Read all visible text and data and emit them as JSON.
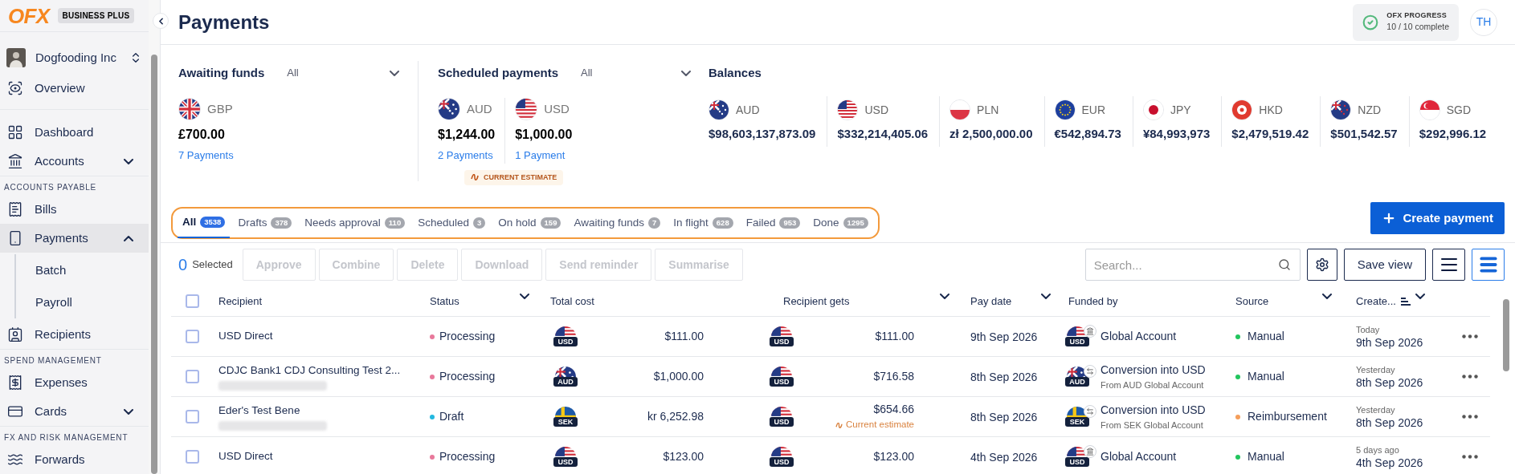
{
  "sidebar": {
    "logo": "OFX",
    "plan": "BUSINESS PLUS",
    "org": "Dogfooding Inc",
    "groups": [
      {
        "items": [
          {
            "label": "Overview",
            "selected": false
          }
        ]
      },
      {
        "items": [
          {
            "label": "Dashboard",
            "selected": false
          },
          {
            "label": "Accounts",
            "selected": false,
            "expanded": false
          }
        ]
      },
      {
        "heading": "ACCOUNTS PAYABLE",
        "items": [
          {
            "label": "Bills",
            "selected": false
          },
          {
            "label": "Payments",
            "selected": true,
            "expanded": true,
            "children": [
              {
                "label": "Batch",
                "selected": false
              },
              {
                "label": "Payroll",
                "selected": false
              }
            ]
          },
          {
            "label": "Recipients",
            "selected": false
          }
        ]
      },
      {
        "heading": "SPEND MANAGEMENT",
        "items": [
          {
            "label": "Expenses",
            "selected": false
          },
          {
            "label": "Cards",
            "selected": false,
            "expanded": false
          }
        ]
      },
      {
        "heading": "FX AND RISK MANAGEMENT",
        "items": [
          {
            "label": "Forwards",
            "selected": false
          }
        ]
      }
    ]
  },
  "header": {
    "title": "Payments",
    "progress": {
      "title": "OFX PROGRESS",
      "text": "10 / 10 complete"
    },
    "user_initials": "TH"
  },
  "awaiting_funds": {
    "title": "Awaiting funds",
    "filter": "All",
    "items": [
      {
        "currency": "GBP",
        "amount": "£700.00",
        "link": "7 Payments"
      }
    ]
  },
  "scheduled_payments": {
    "title": "Scheduled payments",
    "filter": "All",
    "items": [
      {
        "currency": "AUD",
        "amount": "$1,244.00",
        "link": "2 Payments"
      },
      {
        "currency": "USD",
        "amount": "$1,000.00",
        "link": "1 Payment"
      }
    ],
    "badge": "CURRENT ESTIMATE"
  },
  "balances": {
    "title": "Balances",
    "items": [
      {
        "currency": "AUD",
        "amount": "$98,603,137,873.09"
      },
      {
        "currency": "USD",
        "amount": "$332,214,405.06"
      },
      {
        "currency": "PLN",
        "amount": "zł 2,500,000.00"
      },
      {
        "currency": "EUR",
        "amount": "€542,894.73"
      },
      {
        "currency": "JPY",
        "amount": "¥84,993,973"
      },
      {
        "currency": "HKD",
        "amount": "$2,479,519.42"
      },
      {
        "currency": "NZD",
        "amount": "$501,542.57"
      },
      {
        "currency": "SGD",
        "amount": "$292,996.12"
      }
    ]
  },
  "tabs": [
    {
      "label": "All",
      "count": "3538",
      "selected": true
    },
    {
      "label": "Drafts",
      "count": "378",
      "selected": false
    },
    {
      "label": "Needs approval",
      "count": "110",
      "selected": false
    },
    {
      "label": "Scheduled",
      "count": "3",
      "selected": false
    },
    {
      "label": "On hold",
      "count": "159",
      "selected": false
    },
    {
      "label": "Awaiting funds",
      "count": "7",
      "selected": false
    },
    {
      "label": "In flight",
      "count": "628",
      "selected": false
    },
    {
      "label": "Failed",
      "count": "953",
      "selected": false
    },
    {
      "label": "Done",
      "count": "1295",
      "selected": false
    }
  ],
  "create_button": "Create payment",
  "toolbar": {
    "selected_count": "0",
    "selected_label": "Selected",
    "actions": [
      {
        "label": "Approve",
        "disabled": true
      },
      {
        "label": "Combine",
        "disabled": true
      },
      {
        "label": "Delete",
        "disabled": true
      },
      {
        "label": "Download",
        "disabled": true
      },
      {
        "label": "Send reminder",
        "disabled": true
      },
      {
        "label": "Summarise",
        "disabled": true
      }
    ],
    "search": {
      "placeholder": "Search..."
    },
    "save_view": "Save view",
    "view_toggles": [
      {
        "selected": false
      },
      {
        "selected": true
      }
    ]
  },
  "table": {
    "header_checked": false,
    "columns": [
      {
        "label": "Recipient",
        "menu": false,
        "sorted": false
      },
      {
        "label": "Status",
        "menu": true,
        "sorted": false
      },
      {
        "label": "Total cost",
        "menu": false,
        "sorted": false
      },
      {
        "label": "Recipient gets",
        "menu": true,
        "sorted": false
      },
      {
        "label": "Pay date",
        "menu": true,
        "sorted": false
      },
      {
        "label": "Funded by",
        "menu": false,
        "sorted": false
      },
      {
        "label": "Source",
        "menu": true,
        "sorted": false
      },
      {
        "label": "Create...",
        "menu": true,
        "sorted": true
      }
    ],
    "rows": [
      {
        "checked": false,
        "recipient": "USD Direct",
        "redacted": false,
        "status": {
          "label": "Processing",
          "color": "#e8799b"
        },
        "total_currency": "USD",
        "total": "$111.00",
        "gets_currency": "USD",
        "gets": "$111.00",
        "pay_date": "9th Sep 2026",
        "funded_currency": "USD",
        "funded_by": "Global Account",
        "source": {
          "label": "Manual",
          "color": "#22c55e"
        },
        "created_relative": "Today",
        "created": "9th Sep 2026"
      },
      {
        "checked": false,
        "recipient": "CDJC Bank1 CDJ Consulting Test 2...",
        "redacted": true,
        "status": {
          "label": "Processing",
          "color": "#e8799b"
        },
        "total_currency": "AUD",
        "total": "$1,000.00",
        "gets_currency": "USD",
        "gets": "$716.58",
        "pay_date": "8th Sep 2026",
        "funded_currency": "AUD",
        "funded_by": "Conversion into USD",
        "funded_from": "From AUD Global Account",
        "source": {
          "label": "Manual",
          "color": "#22c55e"
        },
        "created_relative": "Yesterday",
        "created": "8th Sep 2026"
      },
      {
        "checked": false,
        "recipient": "Eder's Test Bene",
        "redacted": true,
        "status": {
          "label": "Draft",
          "color": "#22b8e0"
        },
        "total_currency": "SEK",
        "total": "kr 6,252.98",
        "gets_currency": "USD",
        "gets": "$654.66",
        "gets_note": "Current estimate",
        "pay_date": "8th Sep 2026",
        "funded_currency": "SEK",
        "funded_by": "Conversion into USD",
        "funded_from": "From SEK Global Account",
        "source": {
          "label": "Reimbursement",
          "color": "#f59e5b"
        },
        "created_relative": "Yesterday",
        "created": "8th Sep 2026"
      },
      {
        "checked": false,
        "recipient": "USD Direct",
        "redacted": false,
        "status": {
          "label": "Processing",
          "color": "#e8799b"
        },
        "total_currency": "USD",
        "total": "$123.00",
        "gets_currency": "USD",
        "gets": "$123.00",
        "pay_date": "4th Sep 2026",
        "funded_currency": "USD",
        "funded_by": "Global Account",
        "source": {
          "label": "Manual",
          "color": "#22c55e"
        },
        "created_relative": "5 days ago",
        "created": "4th Sep 2026"
      }
    ]
  }
}
